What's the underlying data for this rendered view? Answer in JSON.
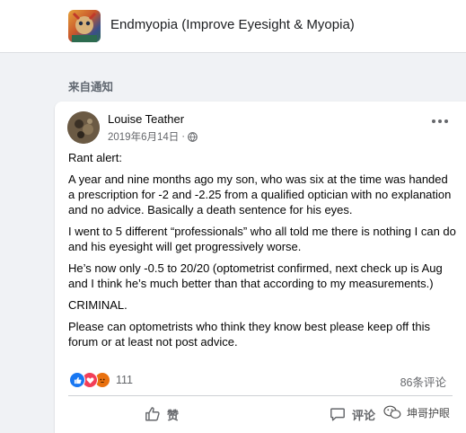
{
  "group": {
    "name": "Endmyopia (Improve Eyesight & Myopia)"
  },
  "section": {
    "label": "来自通知"
  },
  "post": {
    "author": "Louise Teather",
    "date": "2019年6月14日",
    "separator": "·",
    "paragraphs": [
      "Rant alert:",
      "A year and nine months ago my son, who was six at the time  was handed a prescription for -2 and -2.25 from a qualified optician with no explanation and no advice. Basically a death sentence for his eyes.",
      "I went to 5 different “professionals” who all told me there is nothing I can do and his eyesight will get progressively worse.",
      "He’s now only -0.5 to 20/20 (optometrist confirmed, next check up is Aug and I think he’s much better than that according to my measurements.)",
      "CRIMINAL.",
      "Please can optometrists who think they know best please keep off this forum or at least not post advice."
    ],
    "reactions": {
      "icons": [
        "like-icon",
        "love-icon",
        "angry-icon"
      ],
      "count": "111"
    },
    "comments": "86条评论",
    "actions": {
      "like": "赞",
      "comment": "评论"
    }
  },
  "watermark": {
    "text": "坤哥护眼"
  },
  "colors": {
    "accent": "#1877f2",
    "love": "#f33e58",
    "angry": "#e9710f",
    "background": "#f0f2f5"
  }
}
